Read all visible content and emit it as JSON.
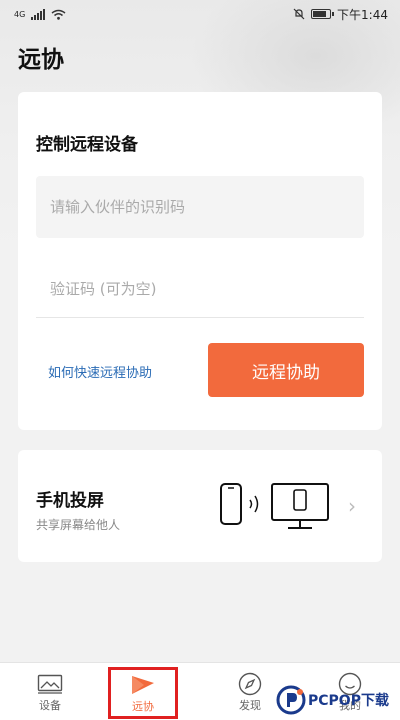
{
  "status_bar": {
    "network": "4G",
    "time": "下午1:44"
  },
  "page": {
    "title": "远协"
  },
  "remote_card": {
    "title": "控制远程设备",
    "partner_id_placeholder": "请输入伙伴的识别码",
    "verification_placeholder": "验证码 (可为空)",
    "help_link": "如何快速远程协助",
    "remote_button": "远程协助"
  },
  "mirror_card": {
    "title": "手机投屏",
    "subtitle": "共享屏幕给他人"
  },
  "bottom_nav": {
    "items": [
      {
        "label": "设备",
        "icon": "image-icon"
      },
      {
        "label": "远协",
        "icon": "remote-assist-icon",
        "active": true
      },
      {
        "label": "发现",
        "icon": "compass-icon"
      },
      {
        "label": "我的",
        "icon": "smiley-icon"
      }
    ]
  },
  "watermark": {
    "text": "PCPOP下载"
  },
  "colors": {
    "accent": "#f26a3d",
    "link": "#2a6bb5",
    "highlight_box": "#e02020"
  }
}
